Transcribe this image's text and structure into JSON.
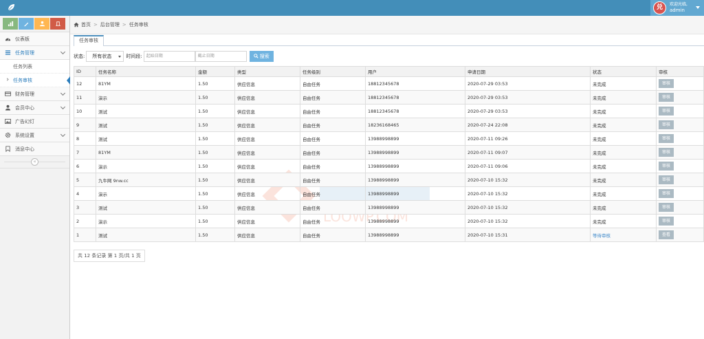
{
  "header": {
    "welcome": "欢迎光临,",
    "username": "admin",
    "avatar_text": "兑",
    "bar_color": "#438eb9"
  },
  "sidebar": {
    "shortcuts": [
      {
        "icon": "signal-icon",
        "color": "#87b87f"
      },
      {
        "icon": "pencil-icon",
        "color": "#6fb3e0"
      },
      {
        "icon": "users-icon",
        "color": "#ffb752"
      },
      {
        "icon": "cogs-icon",
        "color": "#d15b47"
      }
    ],
    "items": [
      {
        "label": "仪表板",
        "icon": "dashboard-icon"
      },
      {
        "label": "任务管理",
        "icon": "list-icon"
      },
      {
        "label": "财务管理",
        "icon": "credit-card-icon"
      },
      {
        "label": "会员中心",
        "icon": "user-icon"
      },
      {
        "label": "广告幻灯",
        "icon": "picture-icon"
      },
      {
        "label": "系统设置",
        "icon": "gear-icon"
      },
      {
        "label": "消息中心",
        "icon": "bookmark-icon"
      }
    ],
    "subitems": [
      {
        "label": "任务列表"
      },
      {
        "label": "任务审核"
      }
    ],
    "collapse_glyph": "«"
  },
  "breadcrumb": {
    "home": "首页",
    "level1": "后台管理",
    "level2": "任务审核",
    "separator": ">"
  },
  "tab": {
    "label": "任务审核"
  },
  "filters": {
    "status_label": "状态:",
    "status_value": "所有状态",
    "period_label": "时间段:",
    "start_placeholder": "起始日期",
    "end_placeholder": "截止日期",
    "search_label": "搜索"
  },
  "table": {
    "columns": [
      "ID",
      "任务名称",
      "金额",
      "类型",
      "任务级别",
      "用户",
      "申请日期",
      "状态",
      "审核"
    ],
    "rows": [
      {
        "id": "12",
        "name": "81YM",
        "amount": "1.50",
        "type": "供应信息",
        "level": "自由任务",
        "user": "18812345678",
        "date": "2020-07-29 03:53",
        "status": "未完成",
        "action": "审核"
      },
      {
        "id": "11",
        "name": "演示",
        "amount": "1.50",
        "type": "供应信息",
        "level": "自由任务",
        "user": "18812345678",
        "date": "2020-07-29 03:53",
        "status": "未完成",
        "action": "审核"
      },
      {
        "id": "10",
        "name": "测试",
        "amount": "1.50",
        "type": "供应信息",
        "level": "自由任务",
        "user": "18812345678",
        "date": "2020-07-29 03:53",
        "status": "未完成",
        "action": "审核"
      },
      {
        "id": "9",
        "name": "测试",
        "amount": "1.50",
        "type": "供应信息",
        "level": "自由任务",
        "user": "18236168465",
        "date": "2020-07-24 22:08",
        "status": "未完成",
        "action": "审核"
      },
      {
        "id": "8",
        "name": "测试",
        "amount": "1.50",
        "type": "供应信息",
        "level": "自由任务",
        "user": "13988998899",
        "date": "2020-07-11 09:26",
        "status": "未完成",
        "action": "审核"
      },
      {
        "id": "7",
        "name": "81YM",
        "amount": "1.50",
        "type": "供应信息",
        "level": "自由任务",
        "user": "13988998899",
        "date": "2020-07-11 09:07",
        "status": "未完成",
        "action": "审核"
      },
      {
        "id": "6",
        "name": "演示",
        "amount": "1.50",
        "type": "供应信息",
        "level": "自由任务",
        "user": "13988998899",
        "date": "2020-07-11 09:06",
        "status": "未完成",
        "action": "审核"
      },
      {
        "id": "5",
        "name": "九牛网 9nw.cc",
        "amount": "1.50",
        "type": "供应信息",
        "level": "自由任务",
        "user": "13988998899",
        "date": "2020-07-10 15:32",
        "status": "未完成",
        "action": "审核"
      },
      {
        "id": "4",
        "name": "演示",
        "amount": "1.50",
        "type": "供应信息",
        "level": "自由任务",
        "user": "13988998899",
        "date": "2020-07-10 15:32",
        "status": "未完成",
        "action": "审核"
      },
      {
        "id": "3",
        "name": "测试",
        "amount": "1.50",
        "type": "供应信息",
        "level": "自由任务",
        "user": "13988998899",
        "date": "2020-07-10 15:32",
        "status": "未完成",
        "action": "审核"
      },
      {
        "id": "2",
        "name": "演示",
        "amount": "1.50",
        "type": "供应信息",
        "level": "自由任务",
        "user": "13988998899",
        "date": "2020-07-10 15:32",
        "status": "未完成",
        "action": "审核"
      },
      {
        "id": "1",
        "name": "测试",
        "amount": "1.50",
        "type": "供应信息",
        "level": "自由任务",
        "user": "13988998899",
        "date": "2020-07-10 15:31",
        "status": "等待审核",
        "action": "查看"
      }
    ]
  },
  "pager": {
    "text": "共 12 条记录 第 1 页/共 1 页"
  },
  "watermark": {
    "text": "LOOWP.COM"
  }
}
